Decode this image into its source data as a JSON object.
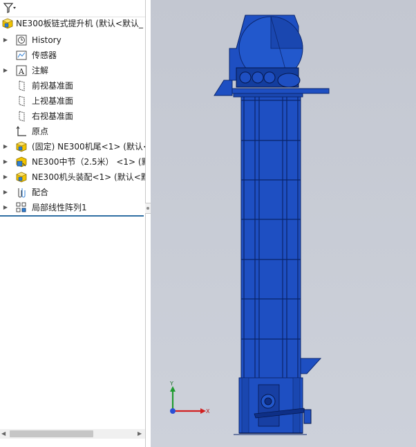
{
  "toolbar": {
    "filter_icon": "filter-icon"
  },
  "tree": {
    "root_label": "NE300板链式提升机  (默认<默认_",
    "items": [
      {
        "label": "History",
        "icon": "history-icon",
        "expandable": true
      },
      {
        "label": "传感器",
        "icon": "sensors-icon",
        "expandable": false
      },
      {
        "label": "注解",
        "icon": "annotations-icon",
        "expandable": true
      },
      {
        "label": "前视基准面",
        "icon": "plane-icon",
        "expandable": false
      },
      {
        "label": "上视基准面",
        "icon": "plane-icon",
        "expandable": false
      },
      {
        "label": "右视基准面",
        "icon": "plane-icon",
        "expandable": false
      },
      {
        "label": "原点",
        "icon": "origin-icon",
        "expandable": false
      },
      {
        "label": "(固定) NE300机尾<1> (默认<",
        "icon": "part-icon",
        "expandable": true
      },
      {
        "label": "NE300中节（2.5米） <1> (默",
        "icon": "subassembly-icon",
        "expandable": true
      },
      {
        "label": "NE300机头装配<1> (默认<默",
        "icon": "part-icon",
        "expandable": true
      },
      {
        "label": "配合",
        "icon": "mates-icon",
        "expandable": true
      },
      {
        "label": "局部线性阵列1",
        "icon": "linear-pattern-icon",
        "expandable": true
      }
    ]
  },
  "triad": {
    "x_label": "X",
    "y_label": "Y"
  },
  "colors": {
    "model_blue": "#1e4fc2",
    "model_dark": "#0e2f86",
    "background": "#c8ccd5"
  }
}
